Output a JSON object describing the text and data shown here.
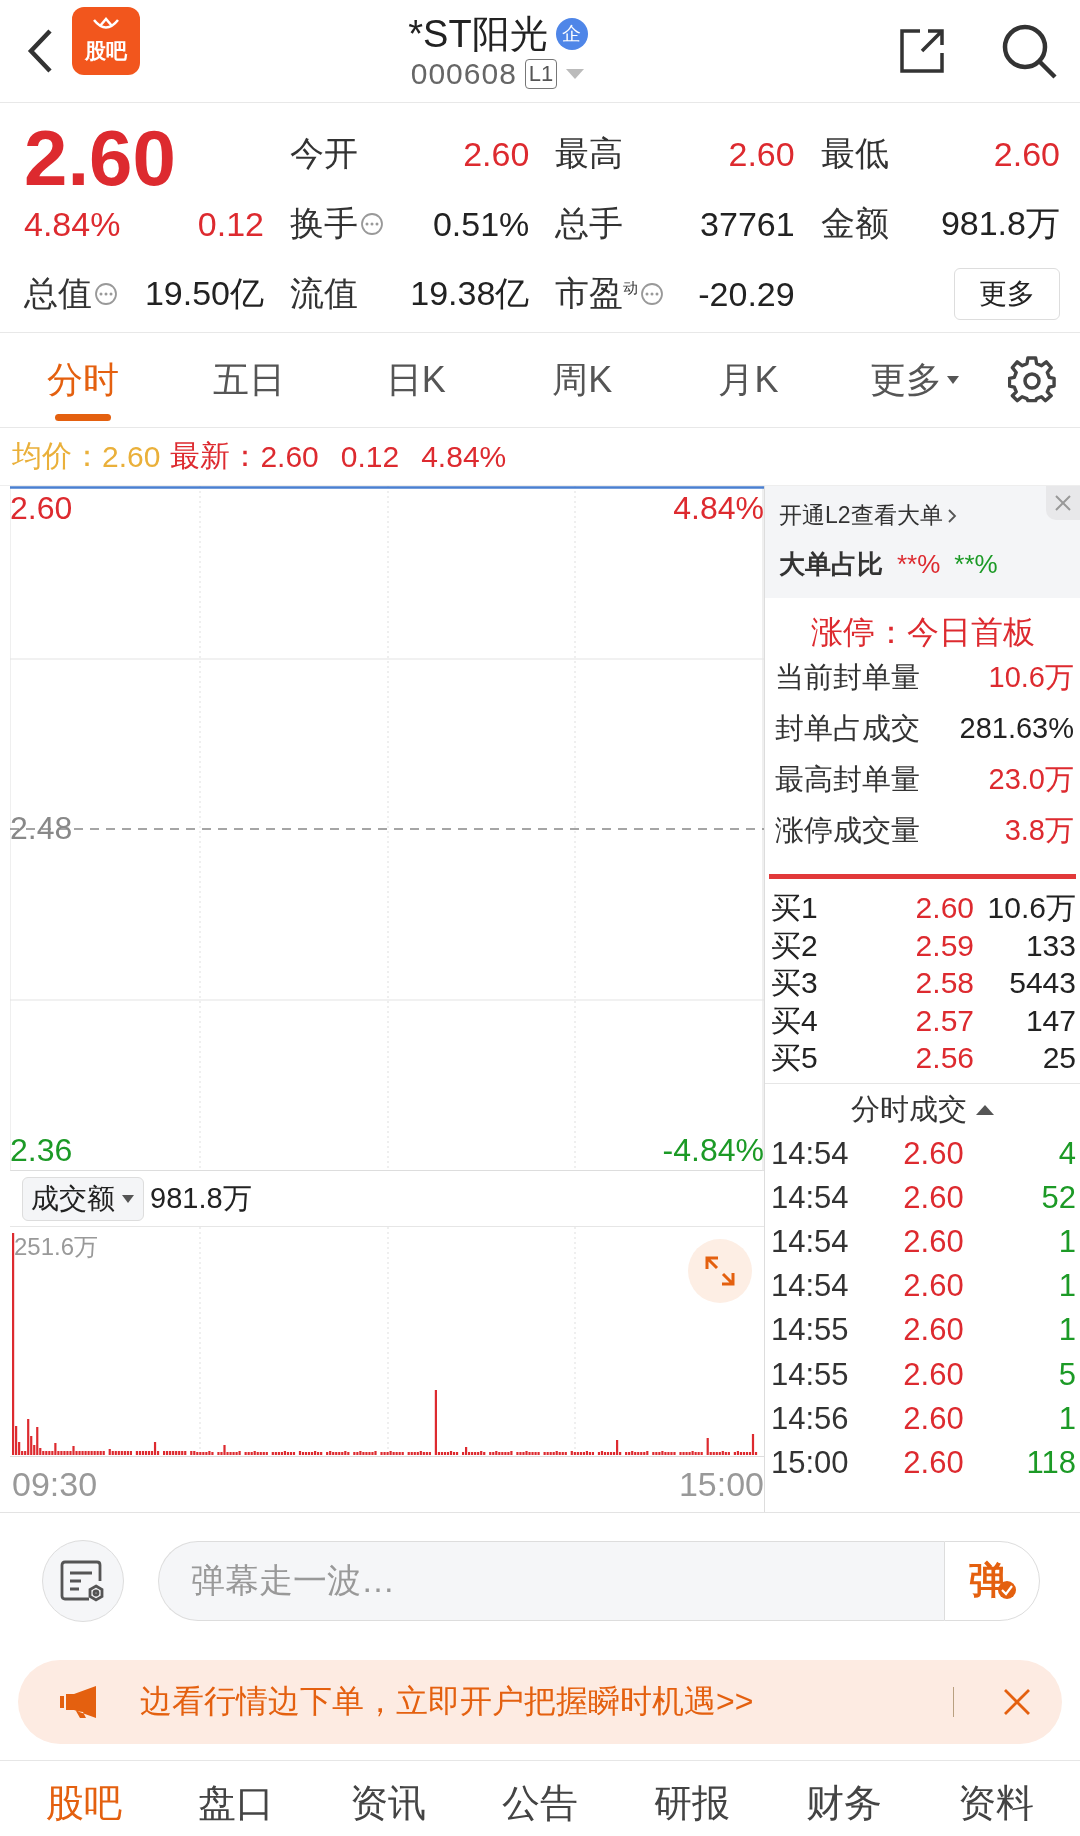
{
  "header": {
    "logo_text": "股吧",
    "title": "*ST阳光",
    "badge": "企",
    "code": "000608",
    "level_tag": "L1"
  },
  "quote": {
    "price": "2.60",
    "change_pct": "4.84%",
    "change": "0.12",
    "stats": [
      {
        "label": "今开",
        "value": "2.60",
        "color": "#dd2a2f",
        "info_icon": false
      },
      {
        "label": "最高",
        "value": "2.60",
        "color": "#dd2a2f",
        "info_icon": false
      },
      {
        "label": "最低",
        "value": "2.60",
        "color": "#dd2a2f",
        "info_icon": false
      },
      {
        "label": "换手",
        "value": "0.51%",
        "color": "#222222",
        "info_icon": true
      },
      {
        "label": "总手",
        "value": "37761",
        "color": "#222222",
        "info_icon": false
      },
      {
        "label": "金额",
        "value": "981.8万",
        "color": "#222222",
        "info_icon": false
      },
      {
        "label": "总值",
        "value": "19.50亿",
        "color": "#222222",
        "info_icon": true
      },
      {
        "label": "流值",
        "value": "19.38亿",
        "color": "#222222",
        "info_icon": false
      },
      {
        "label": "市盈$^{动}$",
        "value": "-20.29",
        "color": "#222222",
        "info_icon": true
      }
    ],
    "more_button": "更多"
  },
  "tabs": [
    {
      "label": "分时",
      "selected": true,
      "dropdown": false
    },
    {
      "label": "五日",
      "selected": false,
      "dropdown": false
    },
    {
      "label": "日K",
      "selected": false,
      "dropdown": false
    },
    {
      "label": "周K",
      "selected": false,
      "dropdown": false
    },
    {
      "label": "月K",
      "selected": false,
      "dropdown": false
    },
    {
      "label": "更多",
      "selected": false,
      "dropdown": true
    }
  ],
  "info_line": {
    "avg_label": "均价：",
    "avg_value": "2.60",
    "latest_label": "最新：",
    "latest_value": "2.60",
    "change": "0.12",
    "change_pct": "4.84%"
  },
  "price_chart": {
    "top_price": "2.60",
    "top_pct": "4.84%",
    "mid_price": "2.48",
    "bottom_price": "2.36",
    "bottom_pct": "-4.84%"
  },
  "volume_chart": {
    "selector": "成交额",
    "total": "981.8万",
    "max_label": "251.6万",
    "start_time": "09:30",
    "end_time": "15:00"
  },
  "side_panel": {
    "l2_link": "开通L2查看大单",
    "big_order_label": "大单占比",
    "big_buy": "**%",
    "big_sell": "**%",
    "limit_status": "涨停：今日首板",
    "limit_stats": [
      {
        "label": "当前封单量",
        "value": "10.6万",
        "color": "#dd2a2f"
      },
      {
        "label": "封单占成交",
        "value": "281.63%",
        "color": "#222222"
      },
      {
        "label": "最高封单量",
        "value": "23.0万",
        "color": "#dd2a2f"
      },
      {
        "label": "涨停成交量",
        "value": "3.8万",
        "color": "#dd2a2f"
      }
    ],
    "bids": [
      {
        "label": "买1",
        "price": "2.60",
        "volume": "10.6万"
      },
      {
        "label": "买2",
        "price": "2.59",
        "volume": "133"
      },
      {
        "label": "买3",
        "price": "2.58",
        "volume": "5443"
      },
      {
        "label": "买4",
        "price": "2.57",
        "volume": "147"
      },
      {
        "label": "买5",
        "price": "2.56",
        "volume": "25"
      }
    ],
    "trades_title": "分时成交",
    "trades": [
      {
        "time": "14:54",
        "price": "2.60",
        "volume": "4"
      },
      {
        "time": "14:54",
        "price": "2.60",
        "volume": "52"
      },
      {
        "time": "14:54",
        "price": "2.60",
        "volume": "1"
      },
      {
        "time": "14:54",
        "price": "2.60",
        "volume": "1"
      },
      {
        "time": "14:55",
        "price": "2.60",
        "volume": "1"
      },
      {
        "time": "14:55",
        "price": "2.60",
        "volume": "5"
      },
      {
        "time": "14:56",
        "price": "2.60",
        "volume": "1"
      },
      {
        "time": "15:00",
        "price": "2.60",
        "volume": "118"
      }
    ]
  },
  "comment_bar": {
    "placeholder": "弹幕走一波…",
    "send_label": "弹"
  },
  "banner": {
    "text": "边看行情边下单，立即开户把握瞬时机遇>>"
  },
  "bottom_nav": [
    {
      "label": "股吧",
      "selected": true
    },
    {
      "label": "盘口",
      "selected": false
    },
    {
      "label": "资讯",
      "selected": false
    },
    {
      "label": "公告",
      "selected": false
    },
    {
      "label": "研报",
      "selected": false
    },
    {
      "label": "财务",
      "selected": false
    },
    {
      "label": "资料",
      "selected": false
    }
  ]
}
